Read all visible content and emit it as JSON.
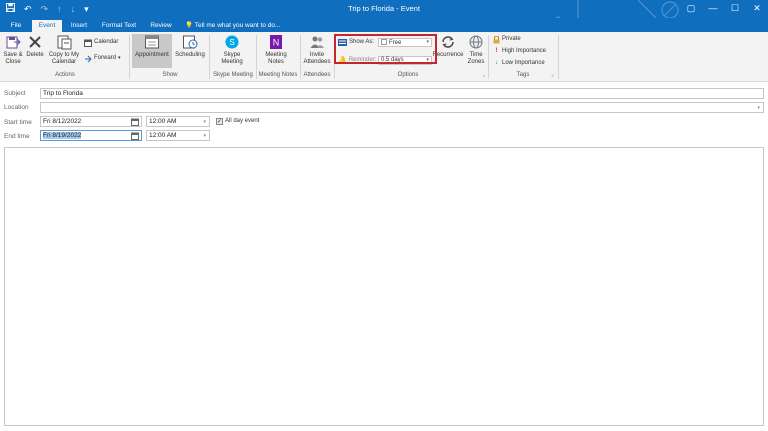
{
  "window": {
    "title": "Trip to Florida - Event",
    "controls": {
      "help": "?",
      "restore": "▢",
      "minimize": "—",
      "maximize": "☐",
      "close": "✕"
    }
  },
  "quick_access": {
    "save": "save-icon",
    "undo": "↶",
    "redo": "↷",
    "up": "↑",
    "down": "↓",
    "more": "▾"
  },
  "tabs": [
    {
      "label": "File",
      "active": false
    },
    {
      "label": "Event",
      "active": true
    },
    {
      "label": "Insert",
      "active": false
    },
    {
      "label": "Format Text",
      "active": false
    },
    {
      "label": "Review",
      "active": false
    }
  ],
  "tell_me": "Tell me what you want to do...",
  "ribbon": {
    "actions": {
      "label": "Actions",
      "save_close": "Save &\nClose",
      "delete": "Delete",
      "copy_calendar": "Copy to My\nCalendar",
      "calendar": "Calendar",
      "forward": "Forward"
    },
    "show": {
      "label": "Show",
      "appointment": "Appointment",
      "scheduling": "Scheduling"
    },
    "skype": {
      "label": "Skype Meeting",
      "button": "Skype\nMeeting"
    },
    "notes": {
      "label": "Meeting Notes",
      "button": "Meeting\nNotes"
    },
    "attendees": {
      "label": "Attendees",
      "button": "Invite\nAttendees"
    },
    "options": {
      "label": "Options",
      "show_as_label": "Show As:",
      "show_as_value": "Free",
      "reminder_label": "Reminder:",
      "reminder_value": "0.5 days",
      "recurrence": "Recurrence",
      "time_zones": "Time\nZones"
    },
    "tags": {
      "label": "Tags",
      "private": "Private",
      "high": "High Importance",
      "low": "Low Importance"
    }
  },
  "form": {
    "subject_label": "Subject",
    "subject_value": "Trip to Florida",
    "location_label": "Location",
    "location_value": "",
    "start_label": "Start time",
    "start_date": "Fri 8/12/2022",
    "start_time": "12:00 AM",
    "end_label": "End time",
    "end_date": "Fri 8/19/2022",
    "end_time": "12:00 AM",
    "all_day_label": "All day event",
    "all_day_checked": true
  },
  "colors": {
    "accent": "#106ebe",
    "ribbon": "#f3f3f3",
    "highlight": "#c1272d"
  }
}
